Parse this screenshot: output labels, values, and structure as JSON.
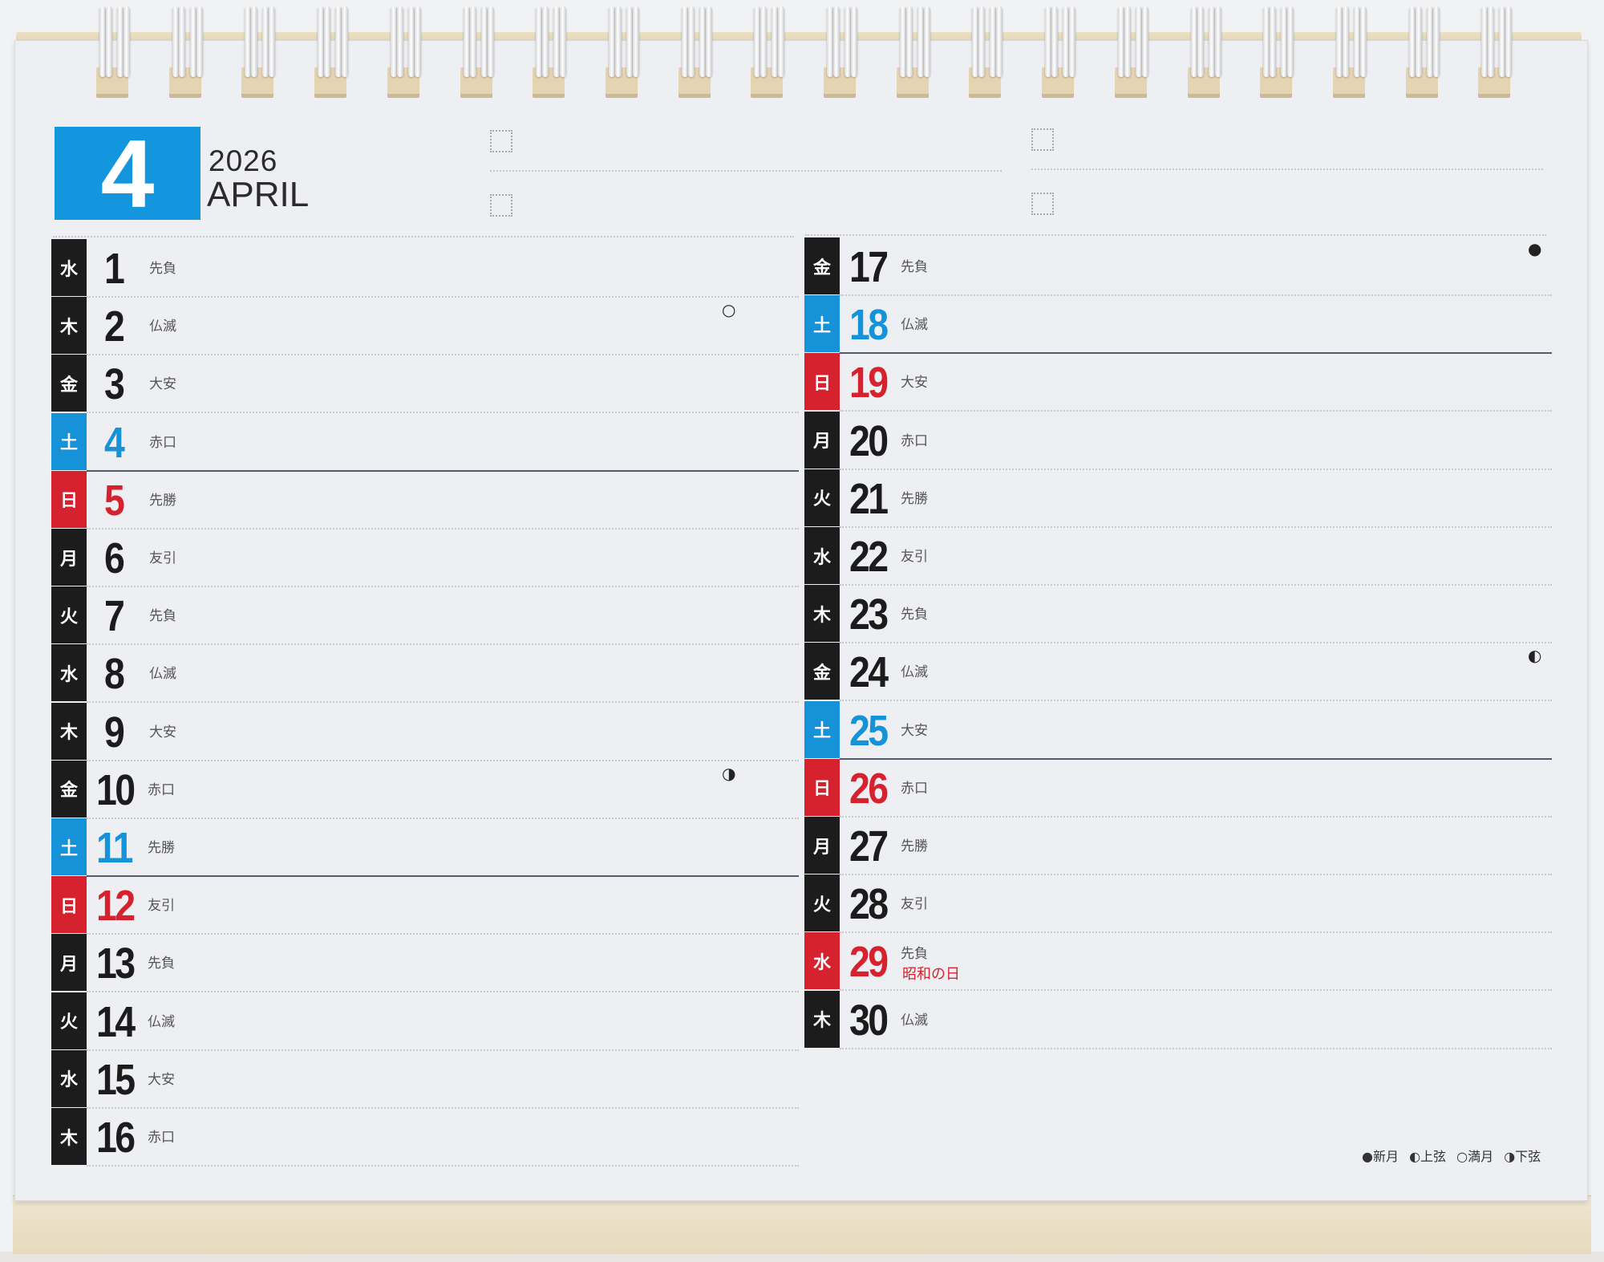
{
  "header": {
    "month_number": "4",
    "year": "2026",
    "month_name": "APRIL"
  },
  "colors": {
    "weekday": "#1c1c1c",
    "saturday": "#1592d8",
    "sunday_holiday": "#d6222f",
    "month_box": "#1496df"
  },
  "left_column": [
    {
      "dow": "水",
      "date": "1",
      "rokuyo": "先負",
      "type": "weekday"
    },
    {
      "dow": "木",
      "date": "2",
      "rokuyo": "仏滅",
      "type": "weekday",
      "moon": "○"
    },
    {
      "dow": "金",
      "date": "3",
      "rokuyo": "大安",
      "type": "weekday"
    },
    {
      "dow": "土",
      "date": "4",
      "rokuyo": "赤口",
      "type": "saturday"
    },
    {
      "dow": "日",
      "date": "5",
      "rokuyo": "先勝",
      "type": "sunday"
    },
    {
      "dow": "月",
      "date": "6",
      "rokuyo": "友引",
      "type": "weekday"
    },
    {
      "dow": "火",
      "date": "7",
      "rokuyo": "先負",
      "type": "weekday"
    },
    {
      "dow": "水",
      "date": "8",
      "rokuyo": "仏滅",
      "type": "weekday"
    },
    {
      "dow": "木",
      "date": "9",
      "rokuyo": "大安",
      "type": "weekday"
    },
    {
      "dow": "金",
      "date": "10",
      "rokuyo": "赤口",
      "type": "weekday",
      "moon": "◑"
    },
    {
      "dow": "土",
      "date": "11",
      "rokuyo": "先勝",
      "type": "saturday"
    },
    {
      "dow": "日",
      "date": "12",
      "rokuyo": "友引",
      "type": "sunday"
    },
    {
      "dow": "月",
      "date": "13",
      "rokuyo": "先負",
      "type": "weekday"
    },
    {
      "dow": "火",
      "date": "14",
      "rokuyo": "仏滅",
      "type": "weekday"
    },
    {
      "dow": "水",
      "date": "15",
      "rokuyo": "大安",
      "type": "weekday"
    },
    {
      "dow": "木",
      "date": "16",
      "rokuyo": "赤口",
      "type": "weekday"
    }
  ],
  "right_column": [
    {
      "dow": "金",
      "date": "17",
      "rokuyo": "先負",
      "type": "weekday",
      "moon": "●"
    },
    {
      "dow": "土",
      "date": "18",
      "rokuyo": "仏滅",
      "type": "saturday"
    },
    {
      "dow": "日",
      "date": "19",
      "rokuyo": "大安",
      "type": "sunday"
    },
    {
      "dow": "月",
      "date": "20",
      "rokuyo": "赤口",
      "type": "weekday"
    },
    {
      "dow": "火",
      "date": "21",
      "rokuyo": "先勝",
      "type": "weekday"
    },
    {
      "dow": "水",
      "date": "22",
      "rokuyo": "友引",
      "type": "weekday"
    },
    {
      "dow": "木",
      "date": "23",
      "rokuyo": "先負",
      "type": "weekday"
    },
    {
      "dow": "金",
      "date": "24",
      "rokuyo": "仏滅",
      "type": "weekday",
      "moon": "◐"
    },
    {
      "dow": "土",
      "date": "25",
      "rokuyo": "大安",
      "type": "saturday"
    },
    {
      "dow": "日",
      "date": "26",
      "rokuyo": "赤口",
      "type": "sunday"
    },
    {
      "dow": "月",
      "date": "27",
      "rokuyo": "先勝",
      "type": "weekday"
    },
    {
      "dow": "火",
      "date": "28",
      "rokuyo": "友引",
      "type": "weekday"
    },
    {
      "dow": "水",
      "date": "29",
      "rokuyo": "先負",
      "type": "holiday",
      "holiday": "昭和の日"
    },
    {
      "dow": "木",
      "date": "30",
      "rokuyo": "仏滅",
      "type": "weekday"
    }
  ],
  "legend": {
    "new_moon": "●新月",
    "first_quarter": "◐上弦",
    "full_moon": "○満月",
    "last_quarter": "◑下弦"
  }
}
